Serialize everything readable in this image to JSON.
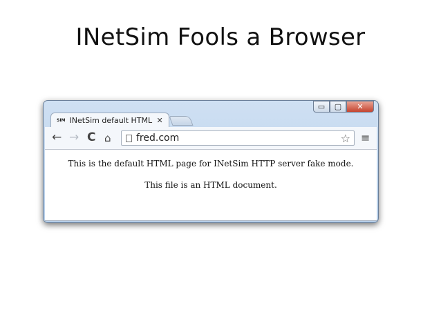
{
  "slide": {
    "title": "INetSim Fools a Browser"
  },
  "window": {
    "controls": {
      "minimize_icon": "minimize-icon",
      "maximize_icon": "maximize-icon",
      "close_icon": "close-icon",
      "minimize_glyph": "▭",
      "maximize_glyph": "▢",
      "close_glyph": "✕"
    }
  },
  "tab": {
    "favicon_text": "SIM",
    "title": "INetSim default HTML page",
    "close_glyph": "✕"
  },
  "toolbar": {
    "back_glyph": "←",
    "forward_glyph": "→",
    "reload_glyph": "C",
    "home_glyph": "⌂",
    "url": "fred.com",
    "star_glyph": "☆",
    "menu_glyph": "≡"
  },
  "page": {
    "line1": "This is the default HTML page for INetSim HTTP server fake mode.",
    "line2": "This file is an HTML document."
  }
}
